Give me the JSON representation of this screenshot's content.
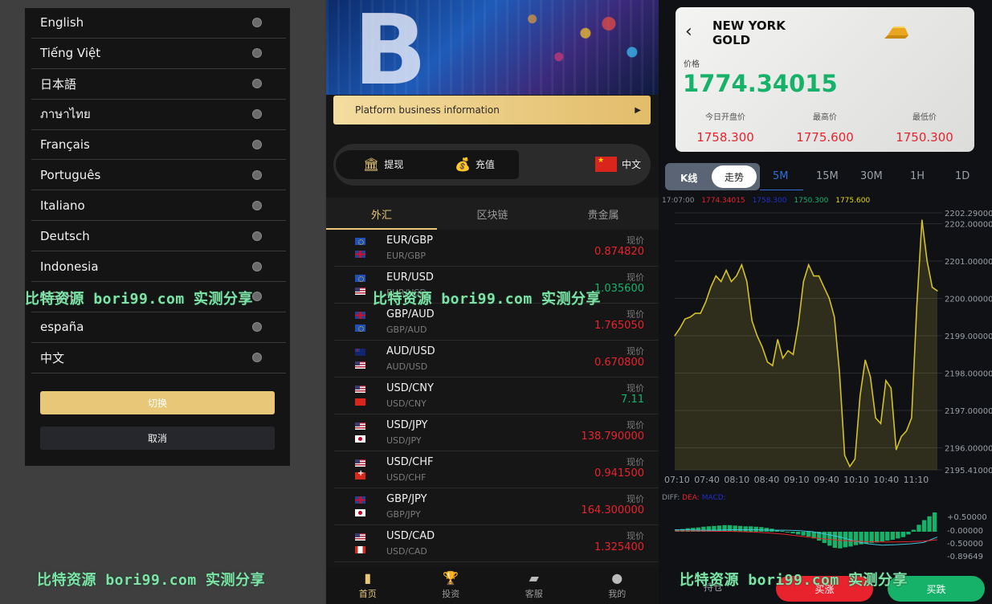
{
  "watermark": "比特资源 bori99.com 实测分享",
  "language_picker": {
    "items": [
      "English",
      "Tiếng Việt",
      "日本語",
      "ภาษาไทย",
      "Français",
      "Português",
      "Italiano",
      "Deutsch",
      "Indonesia",
      "한국어",
      "españa",
      "中文"
    ],
    "switch_label": "切换",
    "cancel_label": "取消"
  },
  "market": {
    "banner_glyph": "B",
    "info_bar": "Platform business information",
    "actions": {
      "withdraw": "提现",
      "deposit": "充值",
      "language": "中文"
    },
    "tabs": [
      "外汇",
      "区块链",
      "贵金属"
    ],
    "price_label": "现价",
    "pairs": [
      {
        "name": "EUR/GBP",
        "sub": "EUR/GBP",
        "price": "0.874820",
        "trend": "down",
        "flags": [
          "eu",
          "gb"
        ]
      },
      {
        "name": "EUR/USD",
        "sub": "EUR/USD",
        "price": "1.035600",
        "trend": "up",
        "flags": [
          "eu",
          "us"
        ]
      },
      {
        "name": "GBP/AUD",
        "sub": "GBP/AUD",
        "price": "1.765050",
        "trend": "down",
        "flags": [
          "gb",
          "eu"
        ]
      },
      {
        "name": "AUD/USD",
        "sub": "AUD/USD",
        "price": "0.670800",
        "trend": "down",
        "flags": [
          "au",
          "us"
        ]
      },
      {
        "name": "USD/CNY",
        "sub": "USD/CNY",
        "price": "7.11",
        "trend": "up",
        "flags": [
          "us",
          "cnm"
        ]
      },
      {
        "name": "USD/JPY",
        "sub": "USD/JPY",
        "price": "138.790000",
        "trend": "down",
        "flags": [
          "us",
          "jp"
        ]
      },
      {
        "name": "USD/CHF",
        "sub": "USD/CHF",
        "price": "0.941500",
        "trend": "down",
        "flags": [
          "us",
          "ch"
        ]
      },
      {
        "name": "GBP/JPY",
        "sub": "GBP/JPY",
        "price": "164.300000",
        "trend": "down",
        "flags": [
          "gb",
          "jp"
        ]
      },
      {
        "name": "USD/CAD",
        "sub": "USD/CAD",
        "price": "1.325400",
        "trend": "down",
        "flags": [
          "us",
          "ca"
        ]
      }
    ],
    "nav": [
      {
        "label": "首页",
        "icon": "bar-chart-icon"
      },
      {
        "label": "投资",
        "icon": "trophy-icon"
      },
      {
        "label": "客服",
        "icon": "chat-icon"
      },
      {
        "label": "我的",
        "icon": "user-icon"
      }
    ]
  },
  "detail": {
    "title": "NEW YORK GOLD",
    "price_label": "价格",
    "price": "1774.34015",
    "stats": [
      {
        "label": "今日开盘价",
        "value": "1758.300"
      },
      {
        "label": "最高价",
        "value": "1775.600"
      },
      {
        "label": "最低价",
        "value": "1750.300"
      }
    ],
    "seg_k": "K线",
    "seg_trend": "走势",
    "periods": [
      "5M",
      "15M",
      "30M",
      "1H",
      "1D"
    ],
    "legend": {
      "time": "17:07:00",
      "v1": "1774.34015",
      "v2": "1758.300",
      "v3": "1750.300",
      "v4": "1775.600"
    },
    "macd_legend": {
      "diff": "DIFF:",
      "dea": "DEA:",
      "macd": "MACD:"
    },
    "hold_label": "持仓",
    "buy_up": "买涨",
    "buy_down": "买跌",
    "colors": {
      "up": "#e8232d",
      "down": "#17b26a",
      "gold": "#e8c778",
      "line": "#d4c02a"
    }
  },
  "chart_data": [
    {
      "type": "line",
      "title": "",
      "xlabel": "",
      "ylabel": "",
      "x_ticks": [
        "07:10",
        "07:40",
        "08:10",
        "08:40",
        "09:10",
        "09:40",
        "10:10",
        "10:40",
        "11:10"
      ],
      "y_ticks": [
        "2202.29000",
        "2202.00000",
        "2201.00000",
        "2200.00000",
        "2199.00000",
        "2198.00000",
        "2197.00000",
        "2196.00000",
        "2195.41000"
      ],
      "ylim": [
        2195.41,
        2202.29
      ],
      "series": [
        {
          "values": [
            2199.0,
            2199.2,
            2199.45,
            2199.5,
            2199.6,
            2199.6,
            2199.9,
            2200.3,
            2200.6,
            2200.45,
            2200.75,
            2200.45,
            2200.6,
            2200.9,
            2200.45,
            2199.4,
            2199.0,
            2198.7,
            2198.3,
            2198.2,
            2198.9,
            2198.4,
            2198.6,
            2198.5,
            2199.3,
            2200.45,
            2200.9,
            2200.6,
            2200.6,
            2200.3,
            2200.0,
            2199.5,
            2198.0,
            2195.8,
            2195.5,
            2195.7,
            2197.4,
            2198.35,
            2197.9,
            2196.8,
            2196.65,
            2197.8,
            2197.6,
            2195.95,
            2196.3,
            2196.45,
            2196.8,
            2199.8,
            2202.1,
            2201.0,
            2200.3,
            2200.2
          ]
        }
      ]
    },
    {
      "type": "bar",
      "title": "",
      "y_ticks": [
        "+0.50000",
        "-0.00000",
        "-0.50000",
        "-0.89649"
      ],
      "ylim": [
        -0.89649,
        0.5
      ],
      "series": [
        {
          "name": "MACD",
          "values": [
            0.06,
            0.07,
            0.09,
            0.1,
            0.11,
            0.13,
            0.14,
            0.15,
            0.16,
            0.17,
            0.17,
            0.16,
            0.15,
            0.14,
            0.14,
            0.13,
            0.12,
            0.1,
            0.08,
            0.05,
            0.02,
            -0.02,
            -0.06,
            -0.1,
            -0.14,
            -0.18,
            -0.25,
            -0.33,
            -0.42,
            -0.52,
            -0.6,
            -0.62,
            -0.58,
            -0.55,
            -0.5,
            -0.47,
            -0.45,
            -0.42,
            -0.4,
            -0.36,
            -0.33,
            -0.3,
            -0.25,
            -0.2,
            -0.1,
            0.05,
            0.18,
            0.3,
            0.4,
            0.5
          ]
        },
        {
          "name": "DIFF",
          "values": [
            0.05,
            0.05,
            0.04,
            0.04,
            0.05,
            0.05,
            0.05,
            0.04,
            0.04,
            0.03,
            0.0,
            -0.1,
            -0.2,
            -0.35,
            -0.45,
            -0.5,
            -0.48,
            -0.45,
            -0.4,
            -0.2
          ]
        },
        {
          "name": "DEA",
          "values": [
            0.02,
            0.02,
            0.02,
            0.01,
            0.01,
            0.0,
            -0.02,
            -0.05,
            -0.1,
            -0.16,
            -0.22,
            -0.28,
            -0.32,
            -0.35,
            -0.37,
            -0.38,
            -0.38,
            -0.37,
            -0.35,
            -0.3
          ]
        }
      ]
    }
  ]
}
